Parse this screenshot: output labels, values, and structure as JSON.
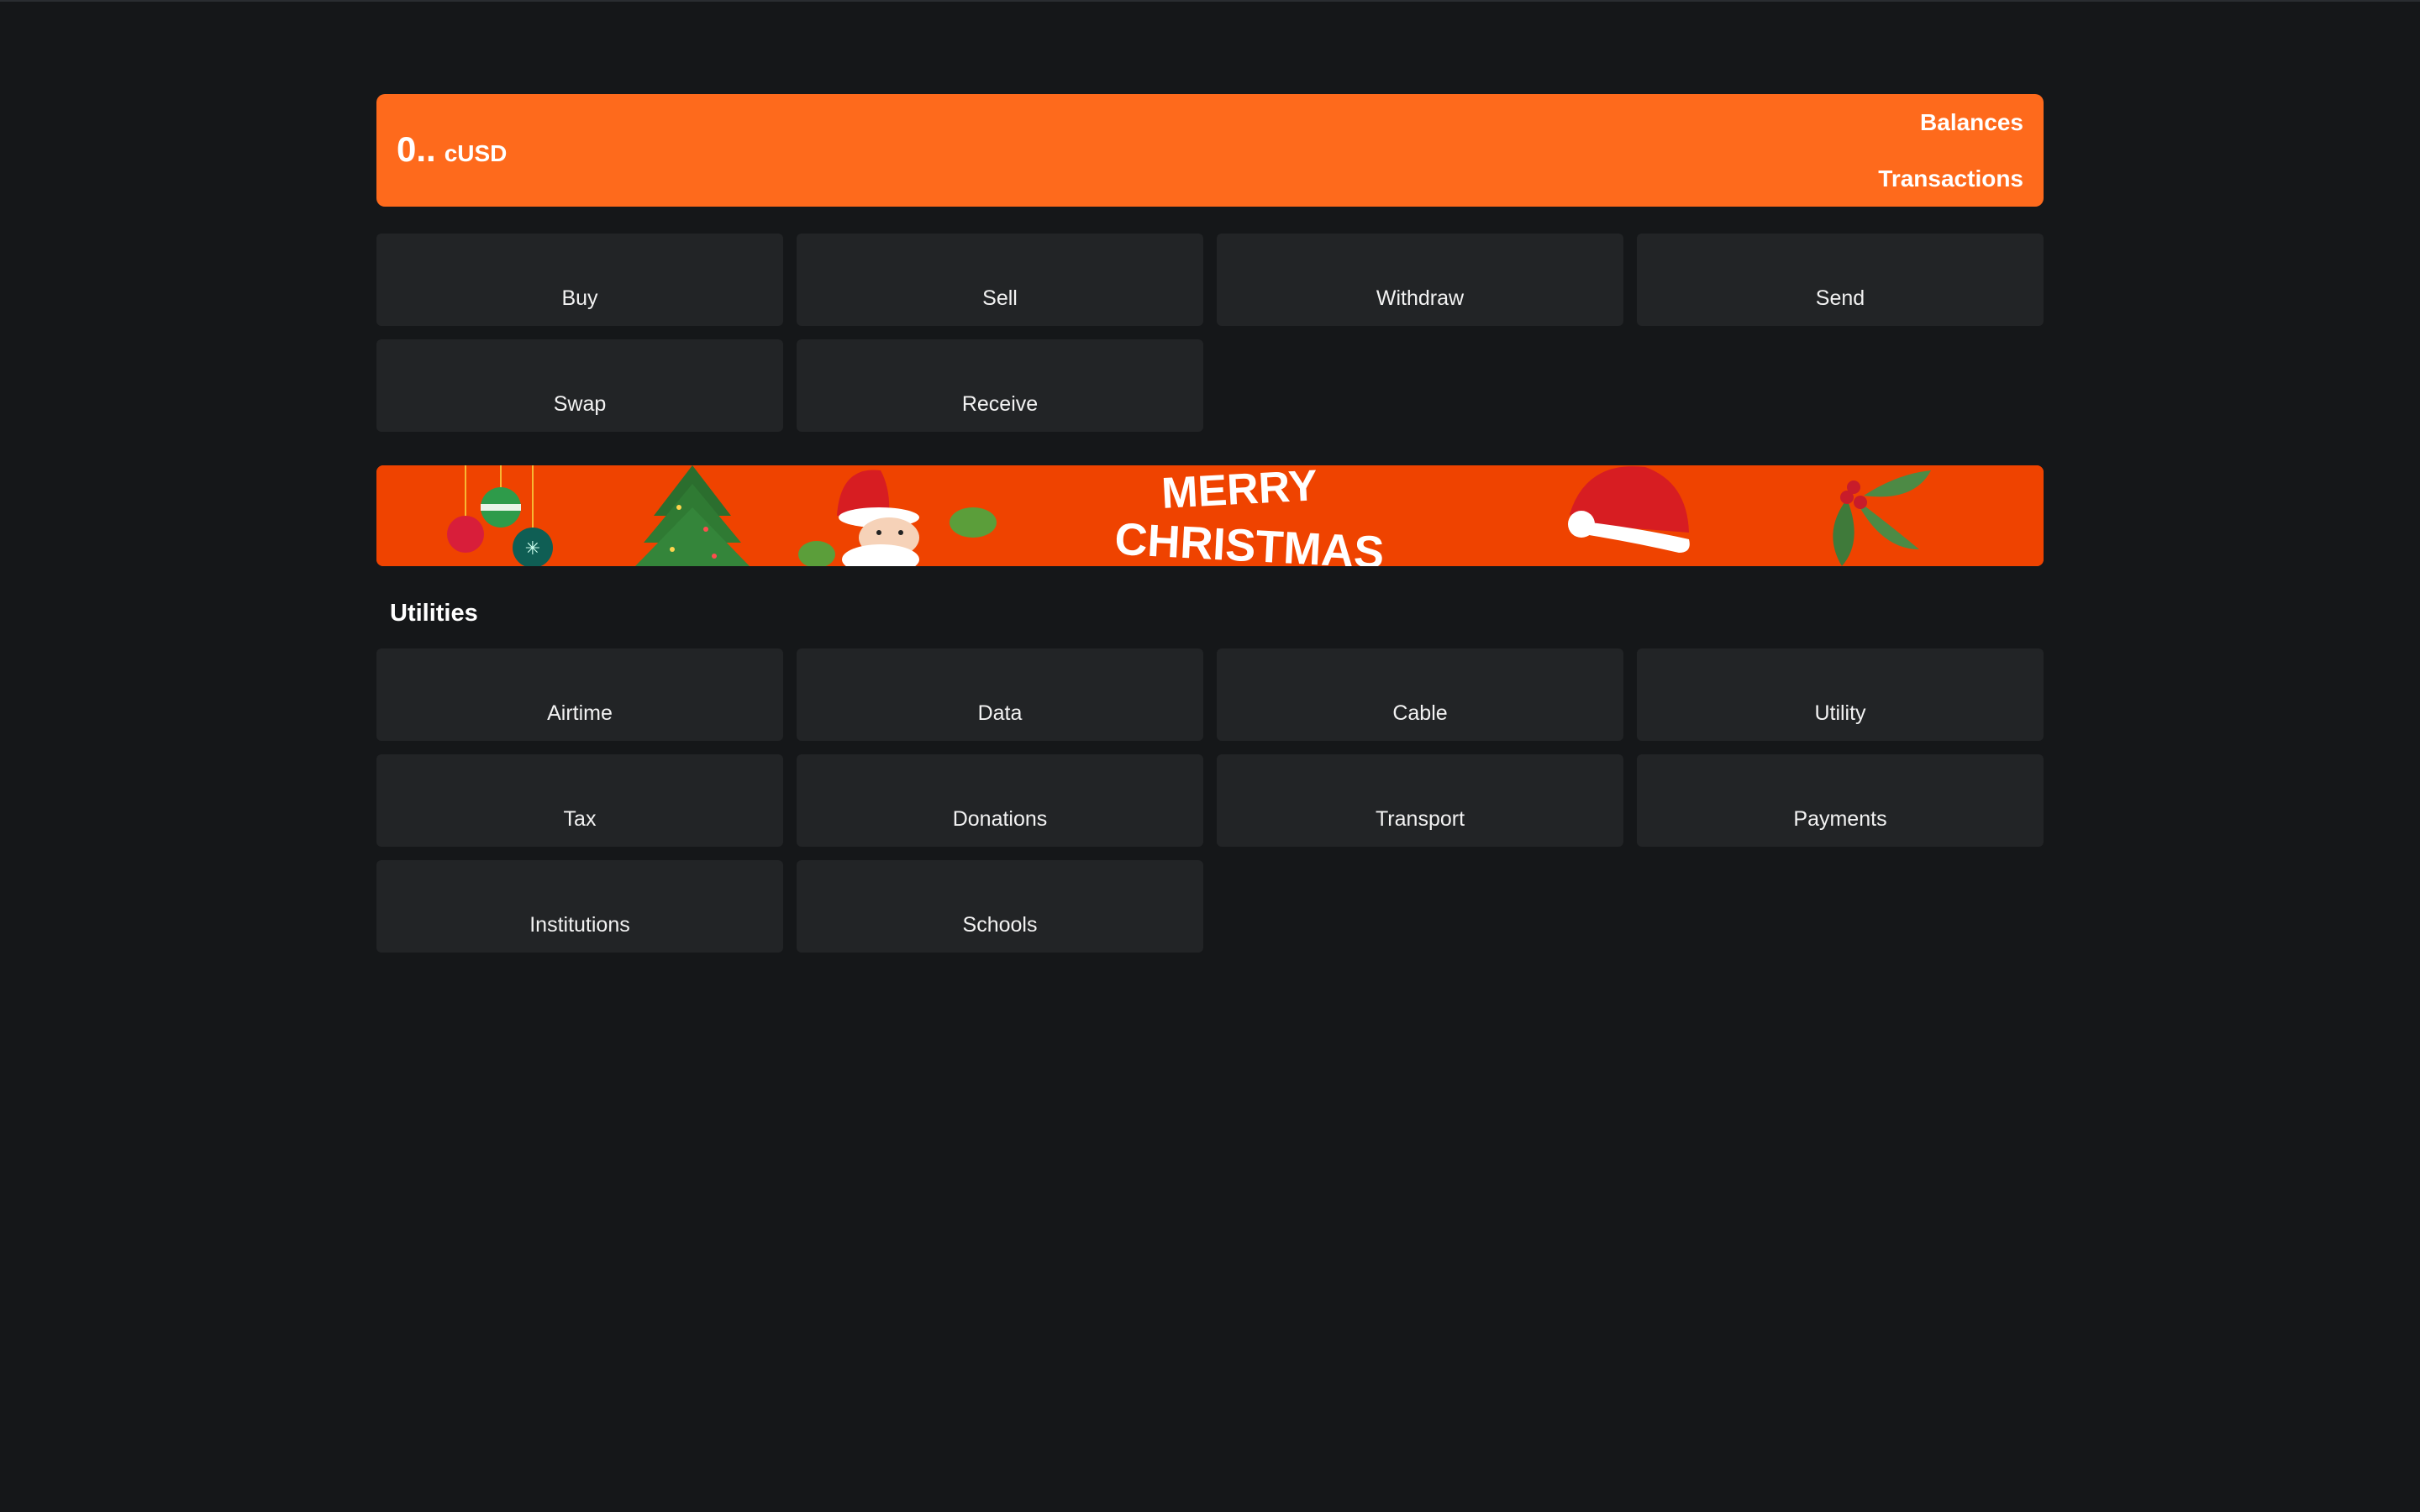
{
  "balance_card": {
    "amount": "0..",
    "currency": "cUSD",
    "balances_link": "Balances",
    "transactions_link": "Transactions"
  },
  "actions": [
    {
      "label": "Buy"
    },
    {
      "label": "Sell"
    },
    {
      "label": "Withdraw"
    },
    {
      "label": "Send"
    },
    {
      "label": "Swap"
    },
    {
      "label": "Receive"
    }
  ],
  "banner": {
    "line1": "MERRY",
    "line2": "CHRISTMAS"
  },
  "utilities": {
    "title": "Utilities",
    "items": [
      {
        "label": "Airtime"
      },
      {
        "label": "Data"
      },
      {
        "label": "Cable"
      },
      {
        "label": "Utility"
      },
      {
        "label": "Tax"
      },
      {
        "label": "Donations"
      },
      {
        "label": "Transport"
      },
      {
        "label": "Payments"
      },
      {
        "label": "Institutions"
      },
      {
        "label": "Schools"
      }
    ]
  },
  "colors": {
    "background": "#151719",
    "accent": "#fe6a1c",
    "tile": "#222426",
    "banner": "#ef4300"
  }
}
